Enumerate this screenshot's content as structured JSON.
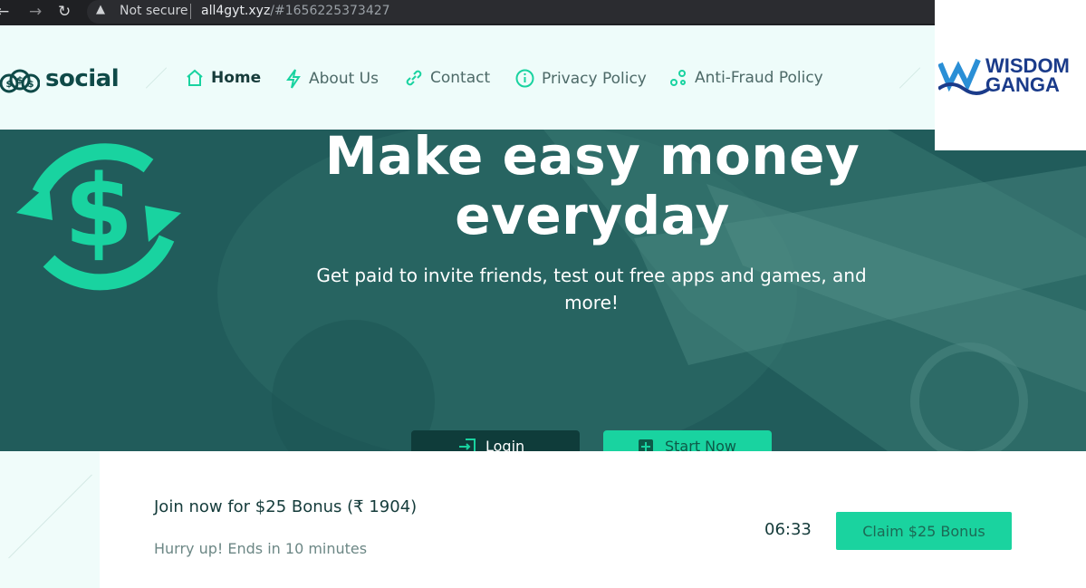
{
  "browser": {
    "security_text": "Not secure",
    "domain": "all4gyt.xyz",
    "path": "/#1656225373427"
  },
  "site": {
    "logo_text": "social",
    "nav": [
      {
        "label": "Home",
        "icon": "home-icon",
        "active": true
      },
      {
        "label": "About Us",
        "icon": "lightning-icon",
        "active": false
      },
      {
        "label": "Contact",
        "icon": "link-icon",
        "active": false
      },
      {
        "label": "Privacy Policy",
        "icon": "info-icon",
        "active": false
      },
      {
        "label": "Anti-Fraud Policy",
        "icon": "nodes-icon",
        "active": false
      }
    ]
  },
  "watermark": {
    "line1": "WISDOM",
    "line2": "GANGA"
  },
  "hero": {
    "title": "Make easy money everyday",
    "subtitle": "Get paid to invite friends, test out free apps and games, and more!",
    "login_label": "Login",
    "start_label": "Start Now"
  },
  "bonus": {
    "title": "Join now for $25 Bonus (₹ 1904)",
    "subtitle": "Hurry up! Ends in 10 minutes",
    "timer": "06:33",
    "claim_label": "Claim $25 Bonus"
  },
  "colors": {
    "accent": "#19d3a0",
    "dark": "#0f3c3a",
    "hero_bg": "#1f5b5b"
  }
}
